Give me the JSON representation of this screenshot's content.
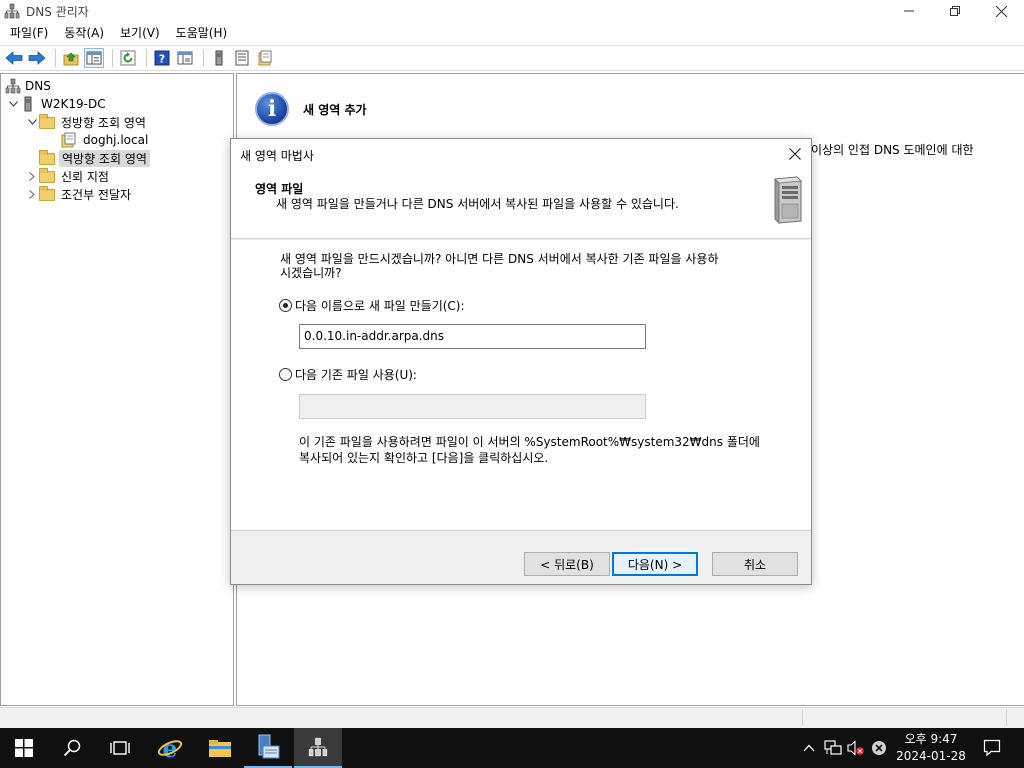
{
  "window": {
    "title": "DNS 관리자",
    "minimize_icon": "minimize-icon",
    "maximize_icon": "restore-icon",
    "close_icon": "close-icon"
  },
  "menu": [
    "파일(F)",
    "동작(A)",
    "보기(V)",
    "도움말(H)"
  ],
  "toolbar_icons": [
    "back-arrow-icon",
    "forward-arrow-icon",
    "up-folder-icon",
    "show-hide-tree-icon",
    "refresh-icon",
    "help-icon",
    "properties-icon",
    "server-icon",
    "list-icon",
    "export-icon"
  ],
  "tree": {
    "root": "DNS",
    "server": "W2K19-DC",
    "forward_zone": "정방향 조회 영역",
    "forward_child": "doghj.local",
    "reverse_zone": "역방향 조회 영역",
    "trust_points": "신뢰 지점",
    "conditional_forwarders": "조건부 전달자"
  },
  "right_pane": {
    "title": "새 영역 추가",
    "text_fragment": "이상의 인접 DNS 도메인에 대한"
  },
  "dialog": {
    "title": "새 영역 마법사",
    "header_title": "영역 파일",
    "header_subtitle": "새 영역 파일을 만들거나 다른 DNS 서버에서 복사된 파일을 사용할 수 있습니다.",
    "question_line1": "새 영역 파일을 만드시겠습니까? 아니면 다른 DNS 서버에서 복사한 기존 파일을 사용하",
    "question_line2": "시겠습니까?",
    "option_new": "다음 이름으로 새 파일 만들기(C):",
    "new_file_value": "0.0.10.in-addr.arpa.dns",
    "option_existing": "다음 기존 파일 사용(U):",
    "existing_file_value": "",
    "note_line1": "이 기존 파일을 사용하려면 파일이 이 서버의 %SystemRoot%₩system32₩dns 폴더에",
    "note_line2": "복사되어 있는지 확인하고 [다음]을 클릭하십시오.",
    "back_button": "< 뒤로(B)",
    "next_button": "다음(N) >",
    "cancel_button": "취소",
    "selected_option": "new"
  },
  "taskbar": {
    "apps": [
      "start-icon",
      "search-icon",
      "task-view-icon",
      "internet-explorer-icon",
      "file-explorer-icon",
      "server-manager-icon",
      "dns-manager-icon"
    ],
    "tray_icons": [
      "chevron-up-icon",
      "network-icon",
      "volume-muted-icon",
      "error-icon",
      "notification-icon"
    ],
    "time": "오후 9:47",
    "date": "2024-01-28"
  },
  "colors": {
    "accent": "#0078d7",
    "taskbar": "#101010",
    "folder": "#f2cf6a",
    "info": "#1b3f9a"
  }
}
